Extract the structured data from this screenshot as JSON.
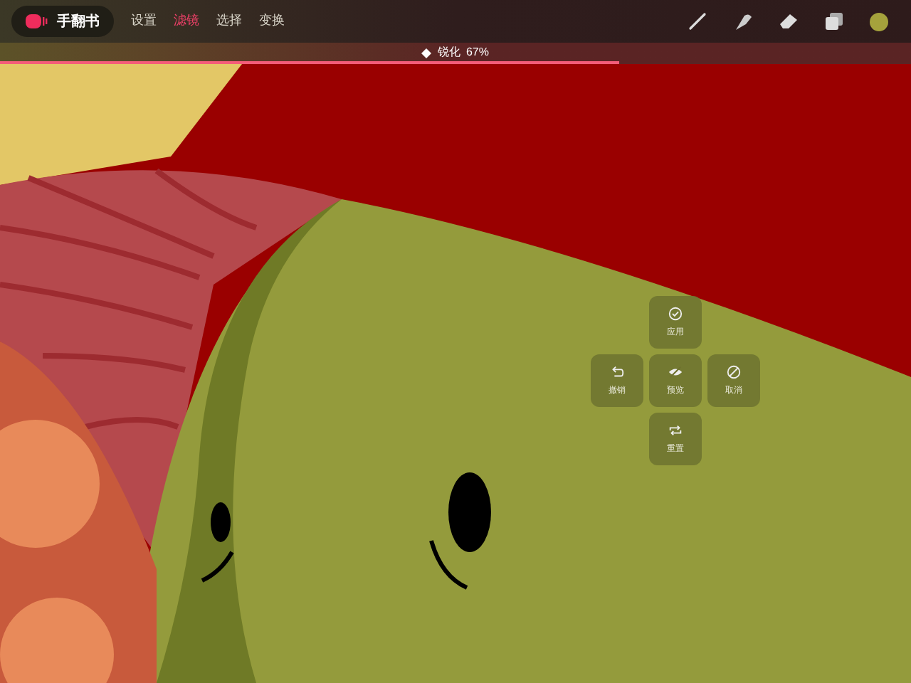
{
  "app": {
    "name": "手翻书"
  },
  "menu": [
    {
      "label": "设置",
      "selected": false
    },
    {
      "label": "滤镜",
      "selected": true
    },
    {
      "label": "选择",
      "selected": false
    },
    {
      "label": "变换",
      "selected": false
    }
  ],
  "filter": {
    "name": "锐化",
    "reading": "67%",
    "level": 0.68
  },
  "actions": [
    {
      "kind": "apply",
      "label": "应用"
    },
    {
      "kind": "undo",
      "label": "撤销"
    },
    {
      "kind": "preview",
      "label": "预览"
    },
    {
      "kind": "cancel",
      "label": "取消"
    },
    {
      "kind": "reset",
      "label": "重置"
    }
  ]
}
